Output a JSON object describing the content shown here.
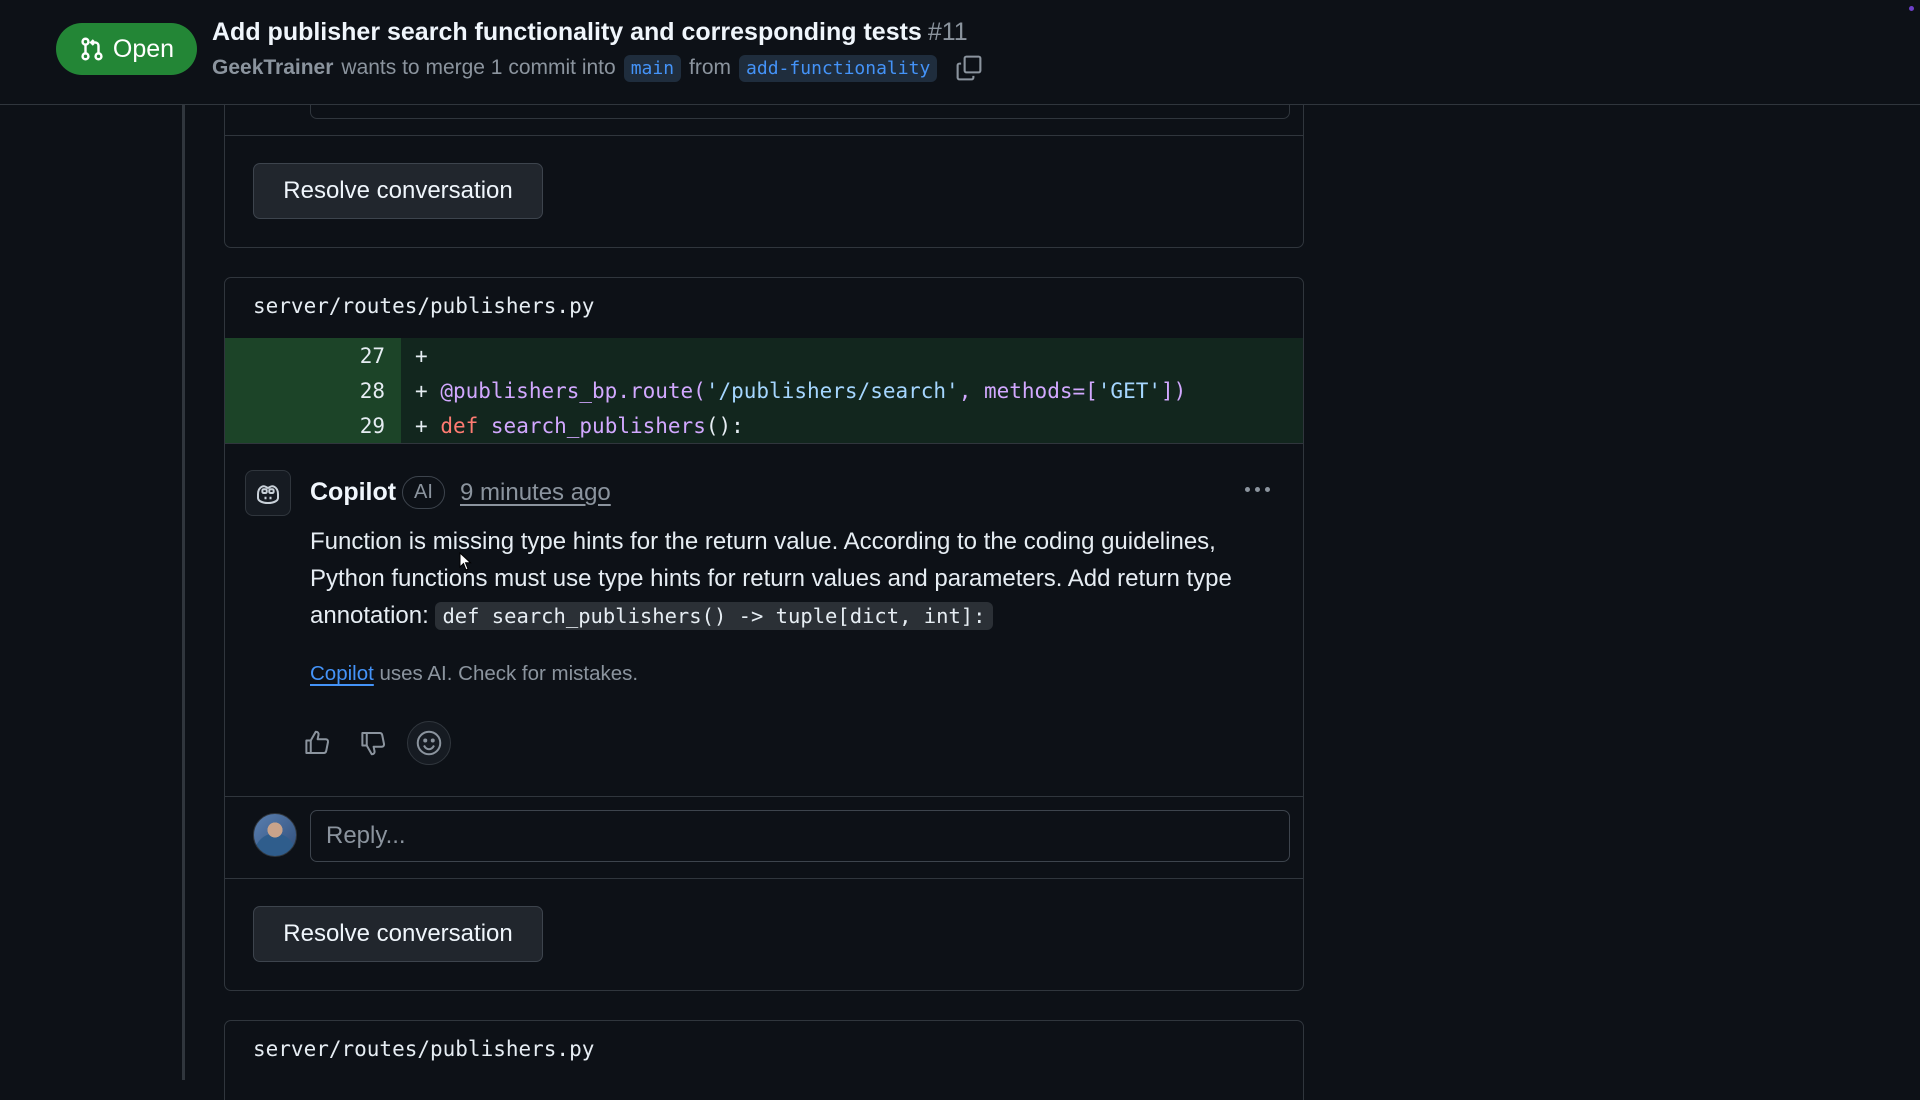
{
  "header": {
    "state": "Open",
    "title": "Add publisher search functionality and corresponding tests",
    "number": "#11",
    "author": "GeekTrainer",
    "merge_text": "wants to merge 1 commit into",
    "base_branch": "main",
    "from_text": "from",
    "head_branch": "add-functionality"
  },
  "prev_thread": {
    "resolve_label": "Resolve conversation"
  },
  "thread": {
    "file_path": "server/routes/publishers.py",
    "diff": [
      {
        "line": "27",
        "prefix": "+",
        "code": ""
      },
      {
        "line": "28",
        "prefix": "+",
        "decorator": "@publishers_bp.route(",
        "string": "'/publishers/search'",
        "mid": ", methods=[",
        "string2": "'GET'",
        "end": "])"
      },
      {
        "line": "29",
        "prefix": "+",
        "keyword": "def",
        "fn": "search_publishers",
        "end": "():"
      }
    ],
    "comment": {
      "author": "Copilot",
      "badge": "AI",
      "time": "9 minutes ago",
      "body": "Function is missing type hints for the return value. According to the coding guidelines, Python functions must use type hints for return values and parameters. Add return type annotation: ",
      "code": "def search_publishers() -> tuple[dict, int]:",
      "disclaimer_link": "Copilot",
      "disclaimer_text": " uses AI. Check for mistakes."
    },
    "reply_placeholder": "Reply...",
    "resolve_label": "Resolve conversation"
  },
  "next_thread": {
    "file_path": "server/routes/publishers.py"
  },
  "colors": {
    "open_green": "#238636",
    "link_blue": "#4493f8",
    "background": "#0d1117"
  },
  "icons": [
    "git-pull-request-icon",
    "copy-icon",
    "copilot-icon",
    "kebab-icon",
    "thumbs-up-icon",
    "thumbs-down-icon",
    "smiley-icon"
  ]
}
